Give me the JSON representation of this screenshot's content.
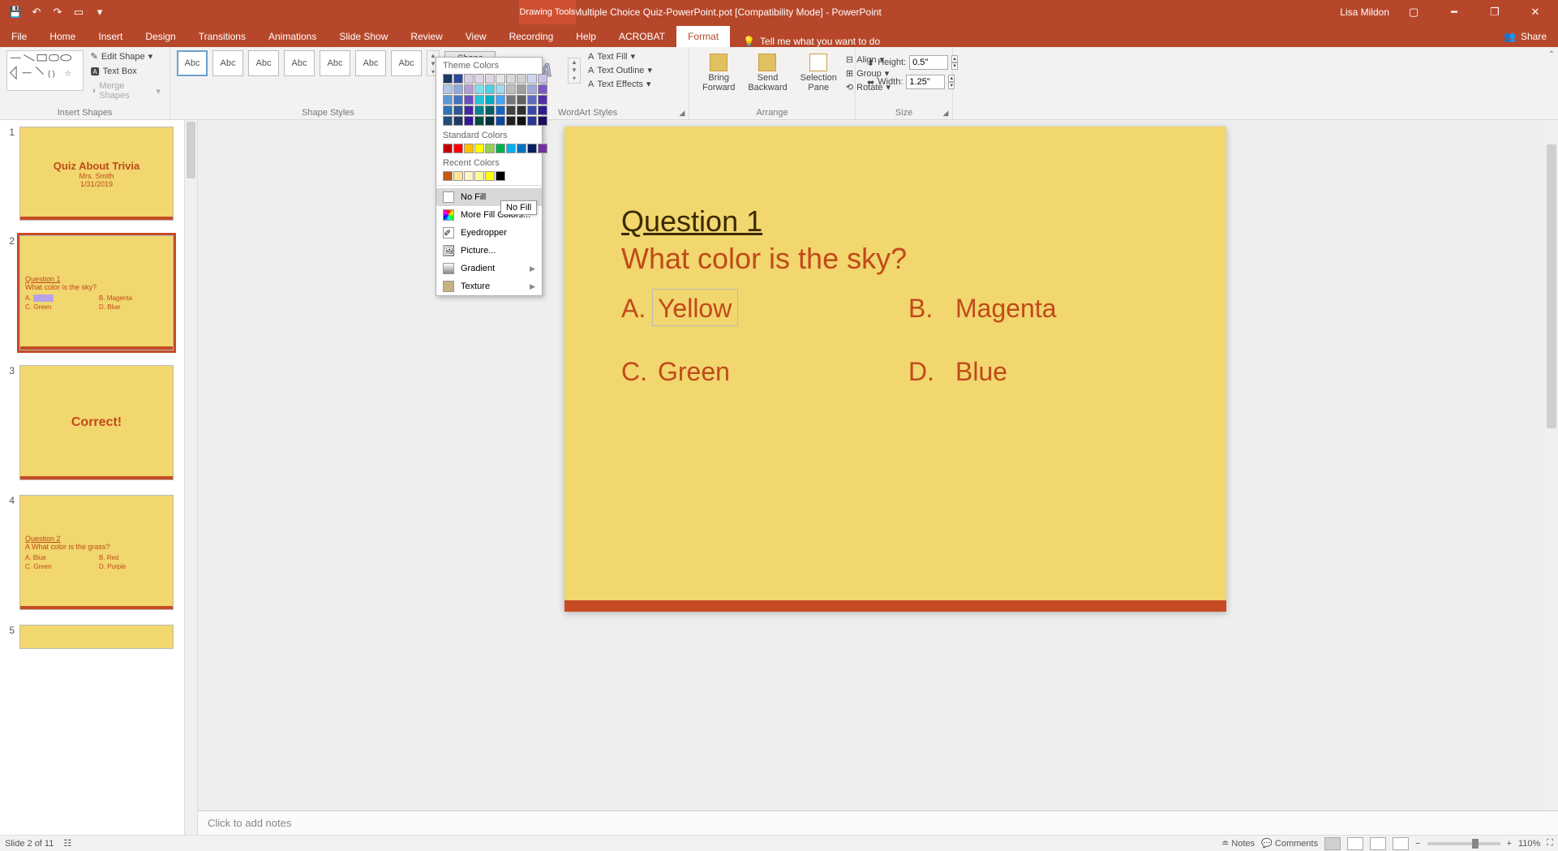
{
  "titlebar": {
    "document_title": "Multiple Choice Quiz-PowerPoint.pot [Compatibility Mode] - PowerPoint",
    "contextual_label": "Drawing Tools",
    "user_name": "Lisa Mildon"
  },
  "tabs": {
    "file": "File",
    "home": "Home",
    "insert": "Insert",
    "design": "Design",
    "transitions": "Transitions",
    "animations": "Animations",
    "slideshow": "Slide Show",
    "review": "Review",
    "view": "View",
    "recording": "Recording",
    "help": "Help",
    "acrobat": "ACROBAT",
    "format": "Format",
    "tell_me": "Tell me what you want to do",
    "share": "Share"
  },
  "ribbon": {
    "insert_shapes": {
      "label": "Insert Shapes",
      "edit_shape": "Edit Shape",
      "text_box": "Text Box",
      "merge_shapes": "Merge Shapes"
    },
    "shape_styles": {
      "label": "Shape Styles",
      "sample": "Abc",
      "shape_fill": "Shape Fill"
    },
    "wordart": {
      "label": "WordArt Styles",
      "text_fill": "Text Fill",
      "text_outline": "Text Outline",
      "text_effects": "Text Effects"
    },
    "arrange": {
      "label": "Arrange",
      "bring_forward": "Bring\nForward",
      "send_backward": "Send\nBackward",
      "selection_pane": "Selection\nPane",
      "align": "Align",
      "group": "Group",
      "rotate": "Rotate"
    },
    "size": {
      "label": "Size",
      "height_label": "Height:",
      "width_label": "Width:",
      "height_value": "0.5\"",
      "width_value": "1.25\""
    }
  },
  "fill_dropdown": {
    "theme_colors": "Theme Colors",
    "standard_colors": "Standard Colors",
    "recent_colors": "Recent Colors",
    "no_fill": "No Fill",
    "more_fill": "More Fill Colors...",
    "eyedropper": "Eyedropper",
    "picture": "Picture...",
    "gradient": "Gradient",
    "texture": "Texture",
    "tooltip": "No Fill",
    "theme_grid": [
      [
        "#1f3864",
        "#2e4a9e",
        "#d9cde3",
        "#e0d6ea",
        "#ded6e2",
        "#e6e6e6",
        "#d9d9d9",
        "#d2d2d2",
        "#cfd5f2",
        "#c9c2ea"
      ],
      [
        "#b4c6e7",
        "#8ea9db",
        "#b39ddb",
        "#80deea",
        "#4dd0e1",
        "#a0d8f0",
        "#bdbdbd",
        "#9e9e9e",
        "#9fa8da",
        "#7e57c2"
      ],
      [
        "#5b9bd5",
        "#4472c4",
        "#6a4fc1",
        "#26c6da",
        "#00acc1",
        "#42a5f5",
        "#757575",
        "#616161",
        "#5c6bc0",
        "#512da8"
      ],
      [
        "#2e75b6",
        "#2f5597",
        "#4527a0",
        "#00838f",
        "#006064",
        "#1565c0",
        "#424242",
        "#303030",
        "#3949ab",
        "#311b92"
      ],
      [
        "#1f4e79",
        "#203864",
        "#311b92",
        "#004d40",
        "#002f3c",
        "#0d47a1",
        "#212121",
        "#111111",
        "#283593",
        "#1a0e5c"
      ]
    ],
    "standard_row": [
      "#c00000",
      "#ff0000",
      "#ffc000",
      "#ffff00",
      "#92d050",
      "#00b050",
      "#00b0f0",
      "#0070c0",
      "#002060",
      "#7030a0"
    ],
    "recent_row": [
      "#c55a11",
      "#ffe699",
      "#fff2cc",
      "#ffff99",
      "#ffff00",
      "#000000"
    ]
  },
  "thumbs": {
    "s1": {
      "title": "Quiz About Trivia",
      "sub1": "Mrs. Smith",
      "sub2": "1/31/2019"
    },
    "s2": {
      "qnum": "Question 1",
      "qtext": "What color is the sky?",
      "a": "A.",
      "b": "B.   Magenta",
      "c": "C.   Green",
      "d": "D.   Blue"
    },
    "s3": {
      "title": "Correct!"
    },
    "s4": {
      "qnum": "Question 2",
      "qtext": "A What color is the grass?",
      "a": "A.   Blue",
      "b": "B.   Red",
      "c": "C.   Green",
      "d": "D.   Purple"
    }
  },
  "slide": {
    "qnum": "Question 1",
    "qtext": "What color is the sky?",
    "a_letter": "A.",
    "a_text": "Yellow",
    "b_letter": "B.",
    "b_text": "Magenta",
    "c_letter": "C.",
    "c_text": "Green",
    "d_letter": "D.",
    "d_text": "Blue"
  },
  "notes": {
    "placeholder": "Click to add notes"
  },
  "status": {
    "slide_info": "Slide 2 of 11",
    "notes": "Notes",
    "comments": "Comments",
    "zoom": "110%"
  }
}
